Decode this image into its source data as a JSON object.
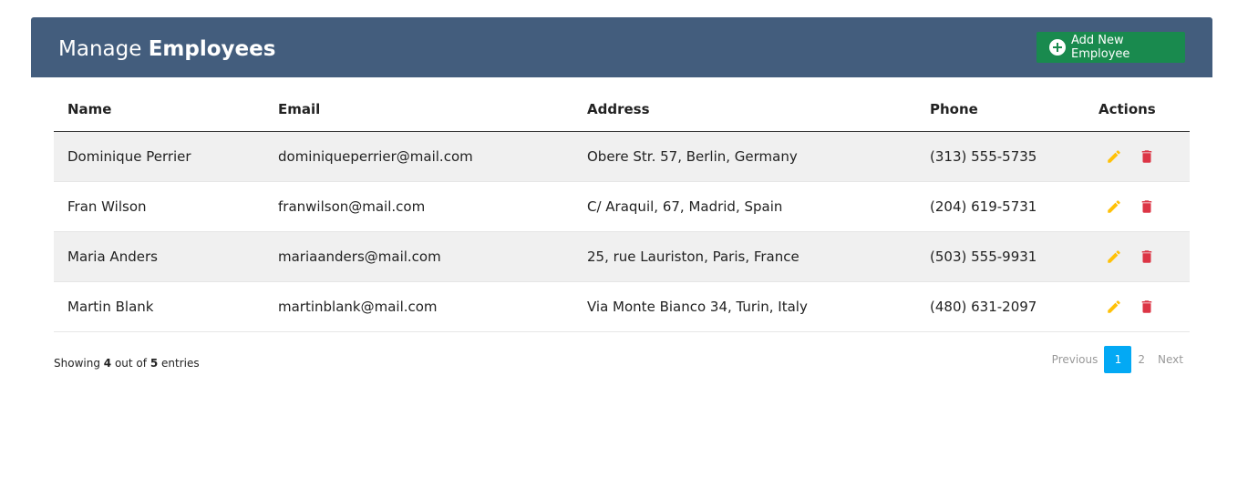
{
  "header": {
    "title_part1": "Manage",
    "title_part2": "Employees",
    "add_label": "Add New Employee"
  },
  "table": {
    "columns": [
      "Name",
      "Email",
      "Address",
      "Phone",
      "Actions"
    ],
    "rows": [
      {
        "name": "Dominique Perrier",
        "email": "dominiqueperrier@mail.com",
        "address": "Obere Str. 57, Berlin, Germany",
        "phone": "(313) 555-5735"
      },
      {
        "name": "Fran Wilson",
        "email": "franwilson@mail.com",
        "address": "C/ Araquil, 67, Madrid, Spain",
        "phone": "(204) 619-5731"
      },
      {
        "name": "Maria Anders",
        "email": "mariaanders@mail.com",
        "address": "25, rue Lauriston, Paris, France",
        "phone": "(503) 555-9931"
      },
      {
        "name": "Martin Blank",
        "email": "martinblank@mail.com",
        "address": "Via Monte Bianco 34, Turin, Italy",
        "phone": "(480) 631-2097"
      }
    ],
    "row_icons": [
      "edit-icon",
      "delete-icon"
    ]
  },
  "footer": {
    "showing_prefix": "Showing",
    "shown_count": "4",
    "middle": "out of",
    "total_count": "5",
    "suffix": "entries"
  },
  "pagination": {
    "previous": "Previous",
    "pages": [
      "1",
      "2"
    ],
    "active_page": "1",
    "next": "Next"
  },
  "colors": {
    "header_bg": "#435d7d",
    "add_button": "#198a4e",
    "edit_icon": "#ffc107",
    "delete_icon": "#dc3545",
    "active_page": "#03a9f4"
  }
}
